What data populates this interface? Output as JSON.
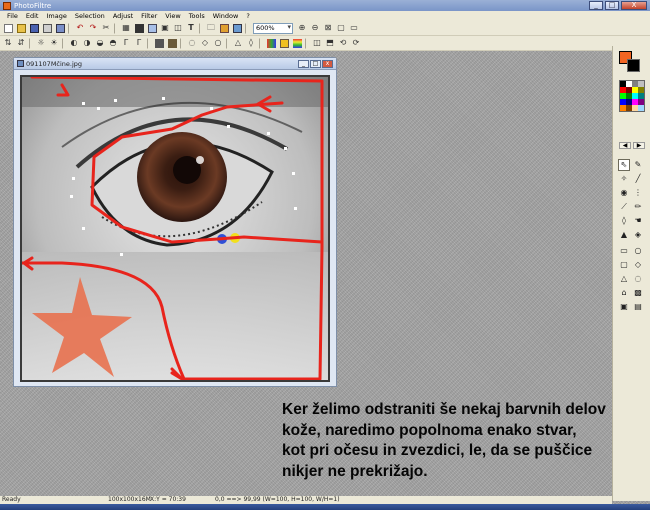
{
  "app": {
    "title": "PhotoFiltre",
    "accent_title_gradient": "#7a95c8",
    "window_buttons": [
      "_",
      "□",
      "X"
    ]
  },
  "menu": {
    "items": [
      "File",
      "Edit",
      "Image",
      "Selection",
      "Adjust",
      "Filter",
      "View",
      "Tools",
      "Window",
      "?"
    ]
  },
  "toolbar": {
    "zoom_value": "600%"
  },
  "document": {
    "filename": "091107Mčine.jpg",
    "window_buttons": [
      "_",
      "□",
      "x"
    ]
  },
  "palette": {
    "foreground_color": "#f26522",
    "background_color": "#000000",
    "swatches": [
      "#000000",
      "#ffffff",
      "#808080",
      "#c0c0c0",
      "#ff0000",
      "#800000",
      "#ffff00",
      "#808000",
      "#00ff00",
      "#008000",
      "#00ffff",
      "#008080",
      "#0000ff",
      "#000080",
      "#ff00ff",
      "#800080",
      "#ff8000",
      "#804000",
      "#ffd8a0",
      "#a0d8ff"
    ],
    "tools": [
      "selection-arrow-icon",
      "eyedropper-icon",
      "magic-wand-icon",
      "line-icon",
      "fill-bucket-icon",
      "spray-icon",
      "brush-icon",
      "pencil-icon",
      "drop-icon",
      "finger-icon",
      "stamp-icon",
      "clone-icon"
    ],
    "shapes": [
      "rectangle-icon",
      "ellipse-icon",
      "rounded-rect-icon",
      "diamond-icon",
      "triangle-icon",
      "lasso-icon",
      "polygon-icon",
      "mask-icon",
      "square-select-icon",
      "picture-icon"
    ]
  },
  "status": {
    "ready": "Ready",
    "image_size": "100x100x16M",
    "cursor": "X:Y = 70:39",
    "color_info": "0,0 ==> 99,99 (W=100, H=100, W/H=1)"
  },
  "caption": {
    "lines": [
      "Ker želimo odstraniti še nekaj barvnih delov",
      "kože, naredimo popolnoma enako stvar,",
      "kot pri očesu in zvezdici, le, da se puščice",
      "nikjer ne prekrižajo."
    ]
  },
  "annotation_color": "#e8241c"
}
